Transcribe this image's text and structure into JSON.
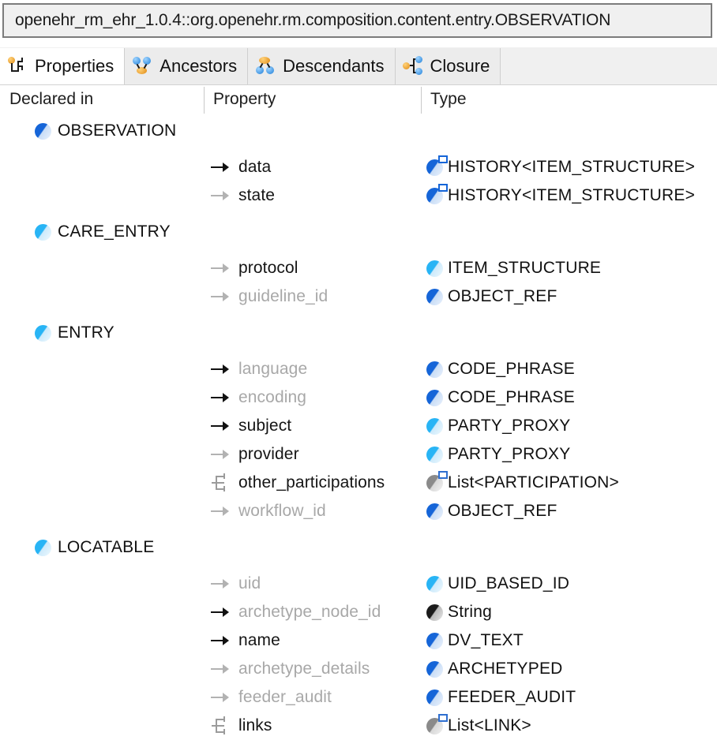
{
  "window": {
    "title": "openehr_rm_ehr_1.0.4::org.openehr.rm.composition.content.entry.OBSERVATION"
  },
  "tabs": [
    {
      "label": "Properties",
      "icon": "properties-tree-icon",
      "selected": true
    },
    {
      "label": "Ancestors",
      "icon": "ancestors-icon",
      "selected": false
    },
    {
      "label": "Descendants",
      "icon": "descendants-icon",
      "selected": false
    },
    {
      "label": "Closure",
      "icon": "closure-icon",
      "selected": false
    }
  ],
  "columns": {
    "declared_in": "Declared in",
    "property": "Property",
    "type": "Type"
  },
  "colors": {
    "concrete_class": "#1565d8",
    "abstract_class": "#28b4f5",
    "primitive_type": "#1b1b1b",
    "generic_container": "#8a8a8a",
    "dim_text": "#a8a8a8",
    "normal_text": "#151515"
  },
  "groups": [
    {
      "name": "OBSERVATION",
      "icon": "class-ball-dark-blue",
      "rows": [
        {
          "property": "data",
          "property_style": "normal",
          "arrow": "arrow-dark",
          "type": "HISTORY<ITEM_STRUCTURE>",
          "type_icon": "class-ball-dark-blue-generic"
        },
        {
          "property": "state",
          "property_style": "normal",
          "arrow": "arrow-dim",
          "type": "HISTORY<ITEM_STRUCTURE>",
          "type_icon": "class-ball-dark-blue-generic"
        }
      ]
    },
    {
      "name": "CARE_ENTRY",
      "icon": "class-ball-light-blue",
      "rows": [
        {
          "property": "protocol",
          "property_style": "normal",
          "arrow": "arrow-dim",
          "type": "ITEM_STRUCTURE",
          "type_icon": "class-ball-light-blue"
        },
        {
          "property": "guideline_id",
          "property_style": "dim",
          "arrow": "arrow-dim",
          "type": "OBJECT_REF",
          "type_icon": "class-ball-dark-blue"
        }
      ]
    },
    {
      "name": "ENTRY",
      "icon": "class-ball-light-blue",
      "rows": [
        {
          "property": "language",
          "property_style": "dim",
          "arrow": "arrow-dark",
          "type": "CODE_PHRASE",
          "type_icon": "class-ball-dark-blue"
        },
        {
          "property": "encoding",
          "property_style": "dim",
          "arrow": "arrow-dark",
          "type": "CODE_PHRASE",
          "type_icon": "class-ball-dark-blue"
        },
        {
          "property": "subject",
          "property_style": "normal",
          "arrow": "arrow-dark",
          "type": "PARTY_PROXY",
          "type_icon": "class-ball-light-blue"
        },
        {
          "property": "provider",
          "property_style": "normal",
          "arrow": "arrow-dim",
          "type": "PARTY_PROXY",
          "type_icon": "class-ball-light-blue"
        },
        {
          "property": "other_participations",
          "property_style": "normal",
          "arrow": "fork",
          "type": "List<PARTICIPATION>",
          "type_icon": "class-ball-gray-generic"
        },
        {
          "property": "workflow_id",
          "property_style": "dim",
          "arrow": "arrow-dim",
          "type": "OBJECT_REF",
          "type_icon": "class-ball-dark-blue"
        }
      ]
    },
    {
      "name": "LOCATABLE",
      "icon": "class-ball-light-blue",
      "rows": [
        {
          "property": "uid",
          "property_style": "dim",
          "arrow": "arrow-dim",
          "type": "UID_BASED_ID",
          "type_icon": "class-ball-light-blue"
        },
        {
          "property": "archetype_node_id",
          "property_style": "dim",
          "arrow": "arrow-dark",
          "type": "String",
          "type_icon": "class-ball-black"
        },
        {
          "property": "name",
          "property_style": "normal",
          "arrow": "arrow-dark",
          "type": "DV_TEXT",
          "type_icon": "class-ball-dark-blue"
        },
        {
          "property": "archetype_details",
          "property_style": "dim",
          "arrow": "arrow-dim",
          "type": "ARCHETYPED",
          "type_icon": "class-ball-dark-blue"
        },
        {
          "property": "feeder_audit",
          "property_style": "dim",
          "arrow": "arrow-dim",
          "type": "FEEDER_AUDIT",
          "type_icon": "class-ball-dark-blue"
        },
        {
          "property": "links",
          "property_style": "normal",
          "arrow": "fork",
          "type": "List<LINK>",
          "type_icon": "class-ball-gray-generic"
        }
      ]
    }
  ]
}
